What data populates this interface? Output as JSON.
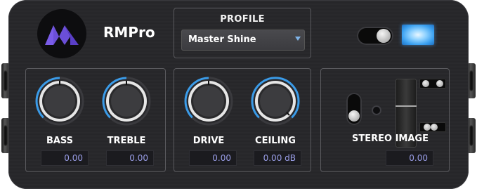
{
  "app": {
    "name": "RMPro"
  },
  "profile": {
    "label": "PROFILE",
    "selected": "Master Shine"
  },
  "power": {
    "on": true
  },
  "tone": {
    "bass": {
      "label": "BASS",
      "value": "0.00"
    },
    "treble": {
      "label": "TREBLE",
      "value": "0.00"
    }
  },
  "dynamics": {
    "drive": {
      "label": "DRIVE",
      "value": "0.00"
    },
    "ceiling": {
      "label": "CEILING",
      "value": "0.00 dB"
    }
  },
  "stereo": {
    "label": "STEREO IMAGE",
    "value": "0.00"
  },
  "colors": {
    "accent": "#3a9be8",
    "value_text": "#9a9ee8",
    "logo_purple": "#6b4fd8"
  }
}
